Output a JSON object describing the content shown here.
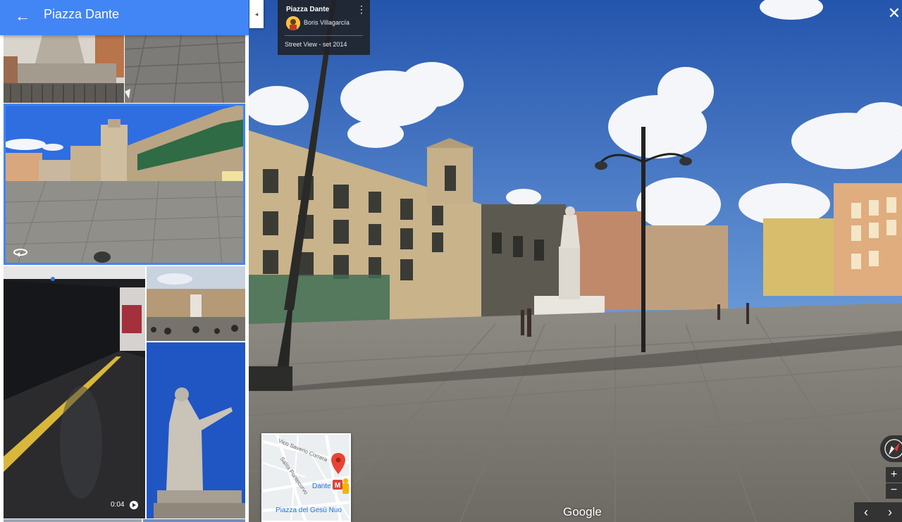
{
  "header": {
    "back_icon": "arrow-back-icon",
    "title": "Piazza Dante"
  },
  "info_card": {
    "title": "Piazza Dante",
    "author": "Boris Villagarcía",
    "date": "Street View - set 2014",
    "menu_icon": "more-vert-icon"
  },
  "collapse_icon": "◂",
  "close_icon": "✕",
  "gallery": {
    "video_duration": "0:04",
    "play_icon": "play-circle-icon",
    "photosphere_icon": "360-icon"
  },
  "minimap": {
    "street1": "Vico Saverio Correra",
    "street2": "Salita Pontecorvo",
    "station_label": "Dante",
    "place_label": "Piazza del Gesù Nuo",
    "marker_color": "#ea4335"
  },
  "brand": "Google",
  "controls": {
    "zoom_in": "+",
    "zoom_out": "−",
    "prev": "‹",
    "next": "›",
    "compass_icon": "compass-icon"
  },
  "colors": {
    "accent": "#4285f4",
    "sky": "#3b6fc4"
  }
}
